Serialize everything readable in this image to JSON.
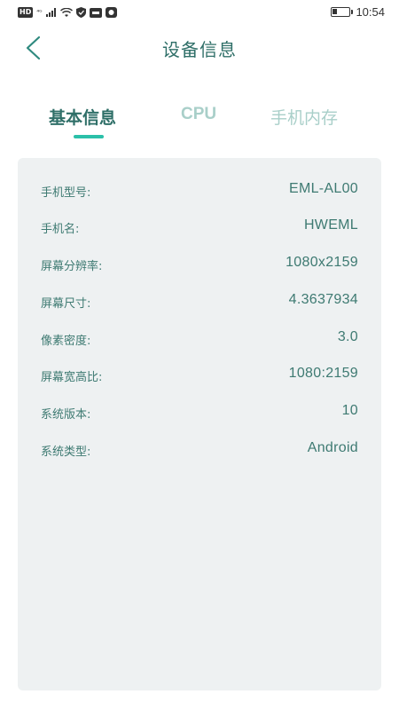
{
  "status_bar": {
    "hd": "HD",
    "signal": "⁴ᴳ",
    "time": "10:54",
    "icons": [
      "hd-icon",
      "signal-icon",
      "wifi-icon",
      "shield-icon",
      "app-icon",
      "app-icon-2",
      "battery-icon"
    ]
  },
  "header": {
    "title": "设备信息",
    "back_icon": "chevron-left-icon"
  },
  "tabs": [
    {
      "label": "基本信息",
      "active": true
    },
    {
      "label": "CPU",
      "active": false
    },
    {
      "label": "手机内存",
      "active": false
    }
  ],
  "info_rows": [
    {
      "label": "手机型号:",
      "value": "EML-AL00"
    },
    {
      "label": "手机名:",
      "value": "HWEML"
    },
    {
      "label": "屏幕分辨率:",
      "value": "1080x2159"
    },
    {
      "label": "屏幕尺寸:",
      "value": "4.3637934"
    },
    {
      "label": "像素密度:",
      "value": "3.0"
    },
    {
      "label": "屏幕宽高比:",
      "value": "1080:2159"
    },
    {
      "label": "系统版本:",
      "value": "10"
    },
    {
      "label": "系统类型:",
      "value": "Android"
    }
  ],
  "colors": {
    "accent": "#2bc0a9",
    "text": "#2f6f68",
    "inactive_tab": "#a9cfc9",
    "card_bg": "#eef1f2"
  }
}
